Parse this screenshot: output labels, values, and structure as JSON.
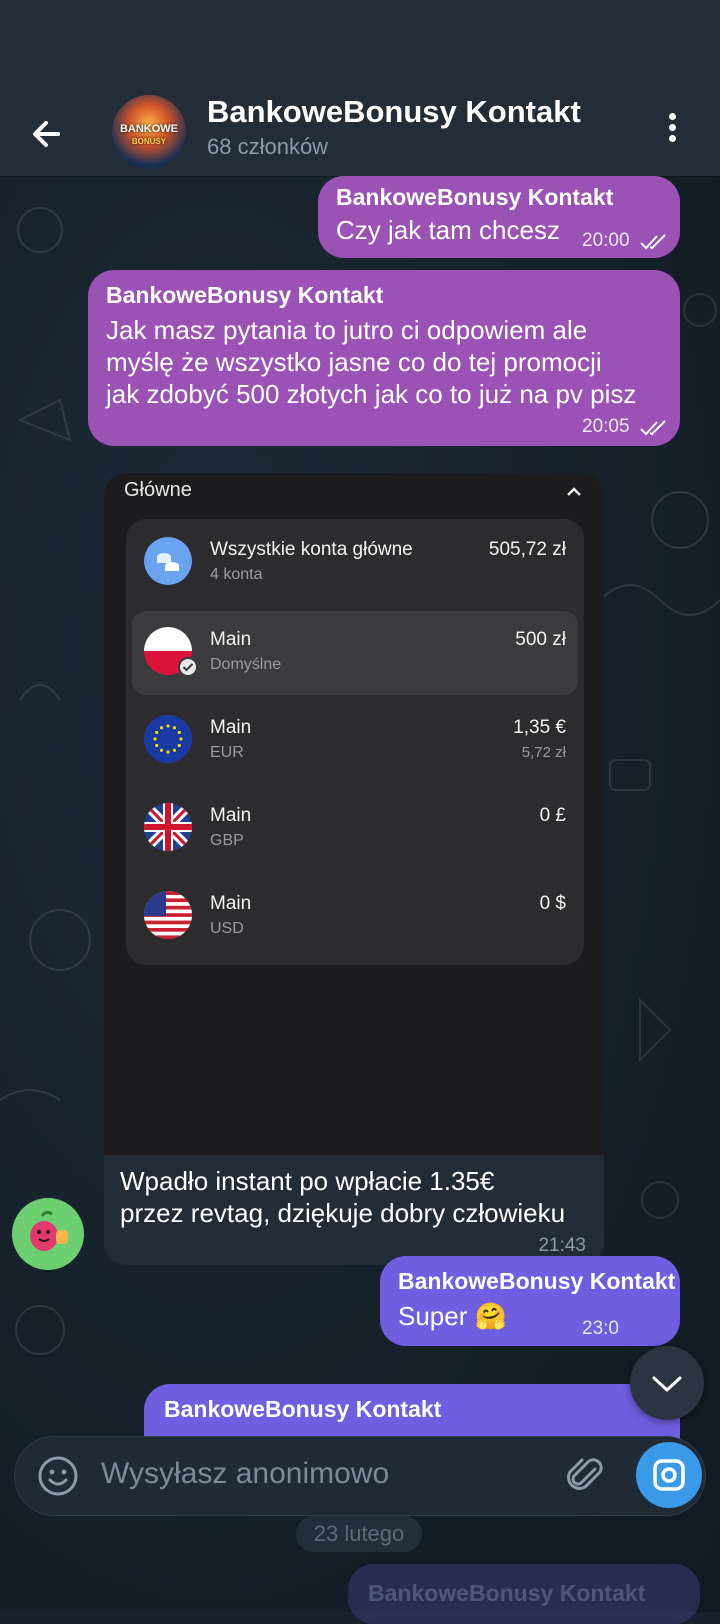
{
  "header": {
    "title": "BankoweBonusy Kontakt",
    "subtitle": "68 członków",
    "avatar_text_1": "BANKOWE",
    "avatar_text_2": "BONUSY"
  },
  "messages": [
    {
      "sender": "BankoweBonusy Kontakt",
      "text": "Czy jak tam chcesz",
      "time": "20:00"
    },
    {
      "sender": "BankoweBonusy Kontakt",
      "lines": [
        "Jak masz pytania to jutro ci odpowiem ale",
        "myślę że wszystko jasne co do tej promocji",
        "jak zdobyć 500 złotych jak co to już na pv pisz"
      ],
      "time": "20:05"
    },
    {
      "sender": "BankoweBonusy Kontakt",
      "text": "Super 🤗",
      "time": "23:0"
    },
    {
      "sender": "BankoweBonusy Kontakt"
    }
  ],
  "incoming": {
    "screenshot": {
      "title": "Główne",
      "caret": "^",
      "accounts": [
        {
          "name": "Wszystkie konta główne",
          "sub": "4 konta",
          "amount": "505,72 zł",
          "amount2": ""
        },
        {
          "name": "Main",
          "sub": "Domyślne",
          "amount": "500 zł",
          "amount2": ""
        },
        {
          "name": "Main",
          "sub": "EUR",
          "amount": "1,35 €",
          "amount2": "5,72 zł"
        },
        {
          "name": "Main",
          "sub": "GBP",
          "amount": "0 £",
          "amount2": ""
        },
        {
          "name": "Main",
          "sub": "USD",
          "amount": "0 $",
          "amount2": ""
        }
      ]
    },
    "caption_lines": [
      "Wpadło instant po wpłacie 1.35€",
      "przez revtag, dziękuje dobry człowieku"
    ],
    "time": "21:43"
  },
  "input": {
    "placeholder": "Wysyłasz anonimowo"
  },
  "date_separator": "23 lutego",
  "colors": {
    "header_bg": "#222d38",
    "outgoing_purple": "#9a52b5",
    "outgoing_violet": "#6e5ee0",
    "accent_blue": "#3b9ae8"
  }
}
